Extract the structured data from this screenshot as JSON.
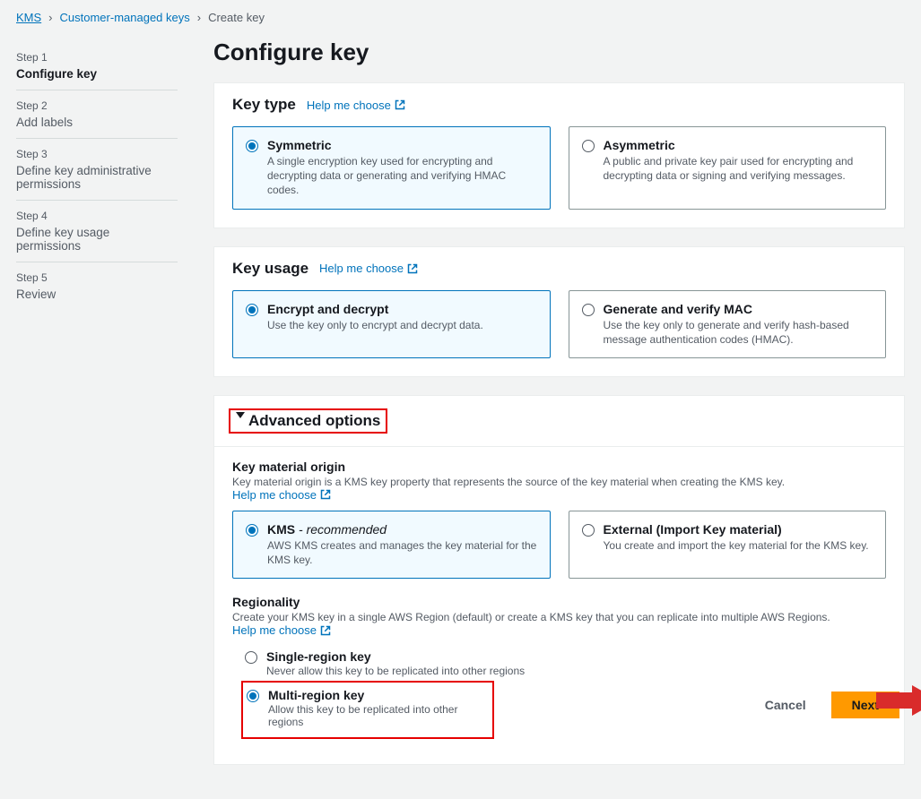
{
  "breadcrumb": {
    "kms": "KMS",
    "cmk": "Customer-managed keys",
    "create": "Create key"
  },
  "steps": [
    {
      "num": "Step 1",
      "name": "Configure key",
      "active": true
    },
    {
      "num": "Step 2",
      "name": "Add labels",
      "active": false
    },
    {
      "num": "Step 3",
      "name": "Define key administrative permissions",
      "active": false
    },
    {
      "num": "Step 4",
      "name": "Define key usage permissions",
      "active": false
    },
    {
      "num": "Step 5",
      "name": "Review",
      "active": false
    }
  ],
  "title": "Configure key",
  "help_link": "Help me choose",
  "key_type": {
    "heading": "Key type",
    "options": [
      {
        "title": "Symmetric",
        "desc": "A single encryption key used for encrypting and decrypting data or generating and verifying HMAC codes.",
        "selected": true
      },
      {
        "title": "Asymmetric",
        "desc": "A public and private key pair used for encrypting and decrypting data or signing and verifying messages.",
        "selected": false
      }
    ]
  },
  "key_usage": {
    "heading": "Key usage",
    "options": [
      {
        "title": "Encrypt and decrypt",
        "desc": "Use the key only to encrypt and decrypt data.",
        "selected": true
      },
      {
        "title": "Generate and verify MAC",
        "desc": "Use the key only to generate and verify hash-based message authentication codes (HMAC).",
        "selected": false
      }
    ]
  },
  "advanced": {
    "heading": "Advanced options",
    "origin_heading": "Key material origin",
    "origin_desc": "Key material origin is a KMS key property that represents the source of the key material when creating the KMS key. ",
    "origin_options": [
      {
        "title": "KMS",
        "rec": " - recommended",
        "desc": "AWS KMS creates and manages the key material for the KMS key.",
        "selected": true
      },
      {
        "title": "External (Import Key material)",
        "desc": "You create and import the key material for the KMS key.",
        "selected": false
      }
    ],
    "region_heading": "Regionality",
    "region_desc": "Create your KMS key in a single AWS Region (default) or create a KMS key that you can replicate into multiple AWS Regions. ",
    "region_options": [
      {
        "title": "Single-region key",
        "desc": "Never allow this key to be replicated into other regions",
        "selected": false
      },
      {
        "title": "Multi-region key",
        "desc": "Allow this key to be replicated into other regions",
        "selected": true
      }
    ]
  },
  "footer": {
    "cancel": "Cancel",
    "next": "Next"
  }
}
